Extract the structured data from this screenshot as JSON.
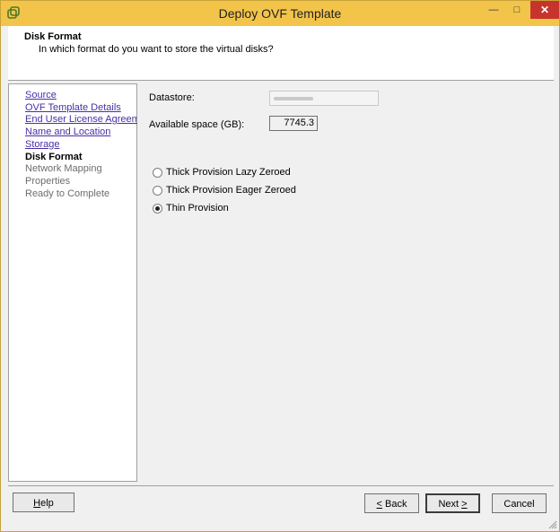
{
  "window": {
    "title": "Deploy OVF Template"
  },
  "header": {
    "title": "Disk Format",
    "subtitle": "In which format do you want to store the virtual disks?"
  },
  "steps": [
    {
      "label": "Source",
      "state": "link"
    },
    {
      "label": "OVF Template Details",
      "state": "link"
    },
    {
      "label": "End User License Agreement",
      "state": "link"
    },
    {
      "label": "Name and Location",
      "state": "link"
    },
    {
      "label": "Storage",
      "state": "link"
    },
    {
      "label": "Disk Format",
      "state": "current"
    },
    {
      "label": "Network Mapping",
      "state": "future"
    },
    {
      "label": "Properties",
      "state": "future"
    },
    {
      "label": "Ready to Complete",
      "state": "future"
    }
  ],
  "form": {
    "datastore_label": "Datastore:",
    "available_label": "Available space (GB):",
    "available_value": "7745.3",
    "options": [
      {
        "label": "Thick Provision Lazy Zeroed",
        "selected": false
      },
      {
        "label": "Thick Provision Eager Zeroed",
        "selected": false
      },
      {
        "label": "Thin Provision",
        "selected": true
      }
    ]
  },
  "buttons": {
    "help_mnemonic": "H",
    "help_rest": "elp",
    "back_mnemonic": "<",
    "back_rest": " Back",
    "next_prefix": "Next ",
    "next_mnemonic": ">",
    "cancel": "Cancel"
  },
  "colors": {
    "titlebar": "#f3c44a",
    "link": "#4a2fa8",
    "close": "#c7342c"
  }
}
